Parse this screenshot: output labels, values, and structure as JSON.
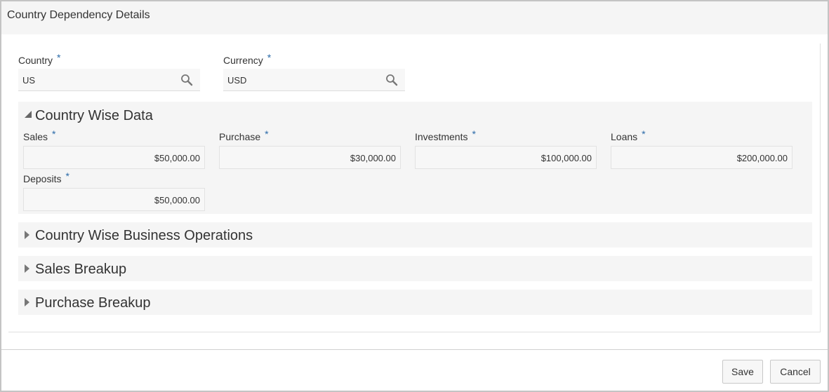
{
  "dialog": {
    "title": "Country Dependency Details"
  },
  "country": {
    "label": "Country",
    "required": "*",
    "value": "US"
  },
  "currency": {
    "label": "Currency",
    "required": "*",
    "value": "USD"
  },
  "sections": {
    "country_wise_data": {
      "title": "Country Wise Data",
      "expanded": true,
      "fields": {
        "sales": {
          "label": "Sales",
          "required": "*",
          "value": "$50,000.00"
        },
        "purchase": {
          "label": "Purchase",
          "required": "*",
          "value": "$30,000.00"
        },
        "investments": {
          "label": "Investments",
          "required": "*",
          "value": "$100,000.00"
        },
        "loans": {
          "label": "Loans",
          "required": "*",
          "value": "$200,000.00"
        },
        "deposits": {
          "label": "Deposits",
          "required": "*",
          "value": "$50,000.00"
        }
      }
    },
    "business_operations": {
      "title": "Country Wise Business Operations",
      "expanded": false
    },
    "sales_breakup": {
      "title": "Sales Breakup",
      "expanded": false
    },
    "purchase_breakup": {
      "title": "Purchase Breakup",
      "expanded": false
    }
  },
  "buttons": {
    "save": "Save",
    "cancel": "Cancel"
  },
  "icons": {
    "lookup": "search-icon",
    "expanded": "triangle-down-icon",
    "collapsed": "triangle-right-icon"
  },
  "colors": {
    "required_asterisk": "#2a6aa8",
    "section_bg": "#f5f5f5"
  }
}
